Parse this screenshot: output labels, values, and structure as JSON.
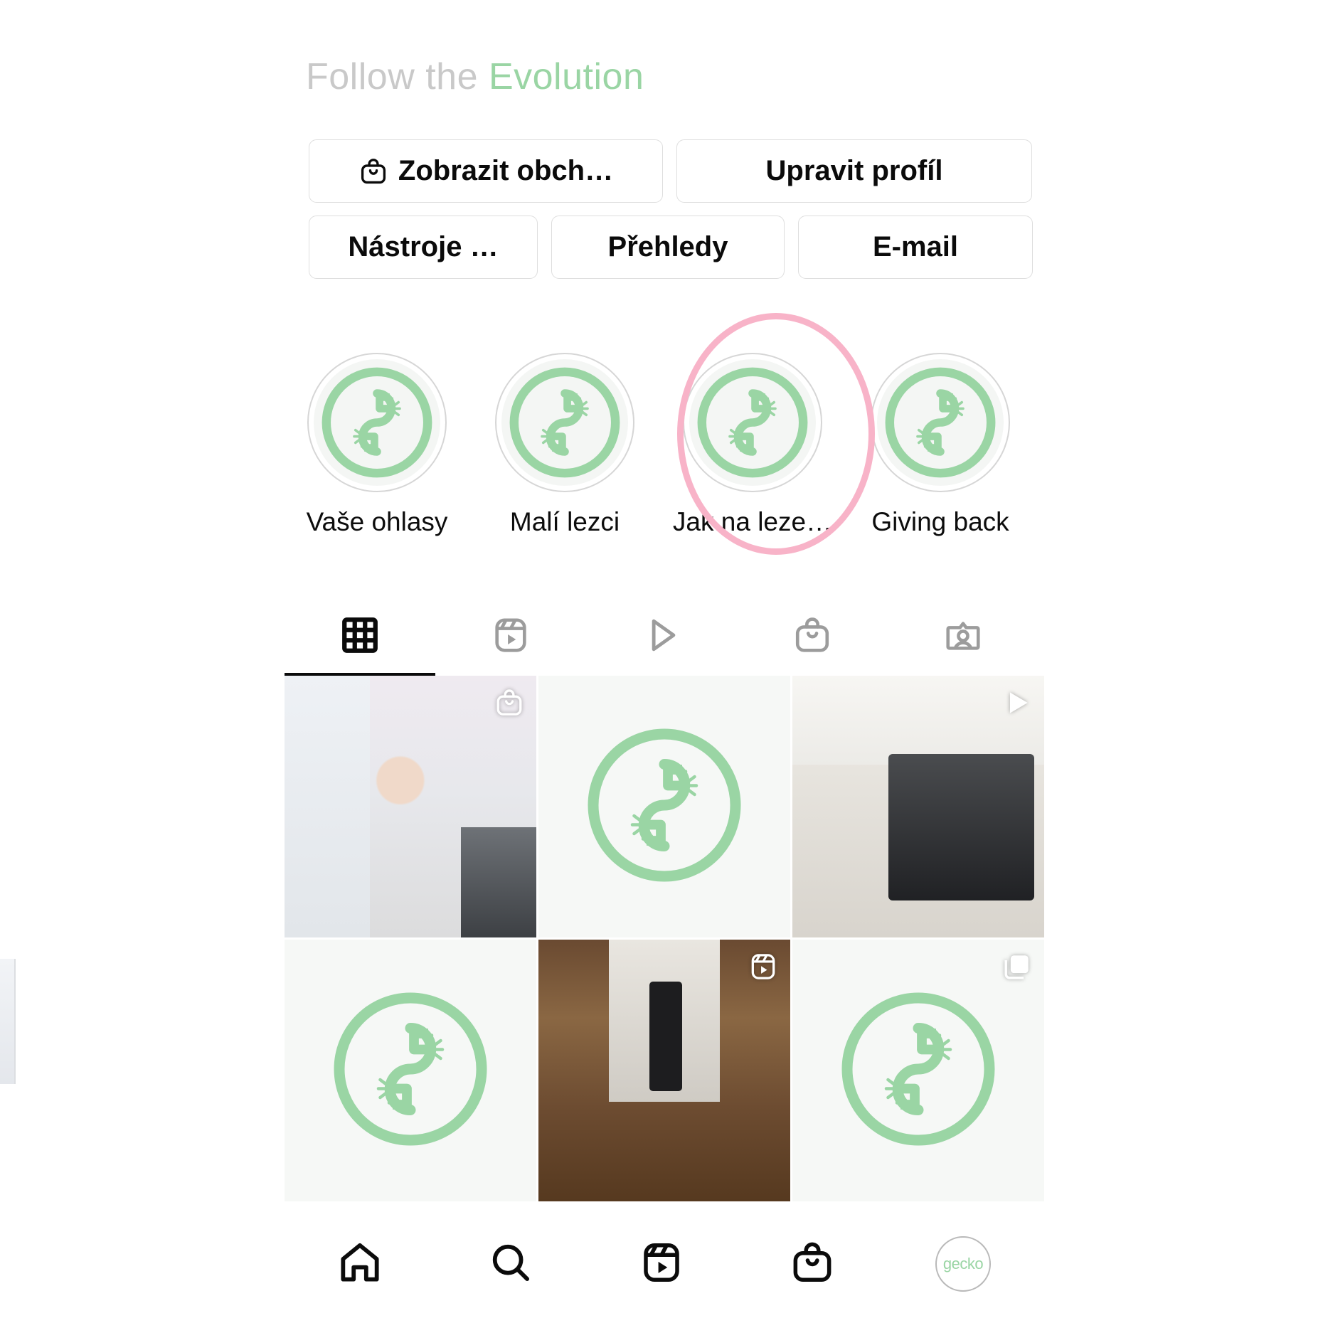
{
  "profile": {
    "bio_plain": "Follow the",
    "bio_accent": "Evolution",
    "accent_color": "#9ad5a4",
    "annotation_color": "#f8b3c8"
  },
  "actions": {
    "row1": [
      {
        "label": "Zobrazit obch…",
        "icon": "shop-bag-icon",
        "name": "view-shop-button"
      },
      {
        "label": "Upravit profíl",
        "icon": "",
        "name": "edit-profile-button"
      }
    ],
    "row2": [
      {
        "label": "Nástroje …",
        "icon": "",
        "name": "tools-button"
      },
      {
        "label": "Přehledy",
        "icon": "",
        "name": "insights-button"
      },
      {
        "label": "E-mail",
        "icon": "",
        "name": "email-button"
      }
    ]
  },
  "highlights": [
    {
      "label": "Vaše ohlasy",
      "name": "highlight-vase-ohlasy",
      "annotated": false
    },
    {
      "label": "Malí lezci",
      "name": "highlight-mali-lezci",
      "annotated": false
    },
    {
      "label": "Jak na leze…",
      "name": "highlight-jak-na-lezeni",
      "annotated": true
    },
    {
      "label": "Giving back",
      "name": "highlight-giving-back",
      "annotated": false
    }
  ],
  "content_tabs": [
    {
      "icon": "grid-icon",
      "name": "tab-grid",
      "active": true
    },
    {
      "icon": "reels-icon",
      "name": "tab-reels",
      "active": false
    },
    {
      "icon": "video-icon",
      "name": "tab-video",
      "active": false
    },
    {
      "icon": "shop-icon",
      "name": "tab-shop",
      "active": false
    },
    {
      "icon": "tagged-icon",
      "name": "tab-tagged",
      "active": false
    }
  ],
  "posts": [
    {
      "kind": "photo",
      "style": "photo-a",
      "badge": "shop-tag-icon"
    },
    {
      "kind": "logo",
      "style": "",
      "badge": ""
    },
    {
      "kind": "photo",
      "style": "photo-b",
      "badge": "video-play-icon"
    },
    {
      "kind": "logo",
      "style": "",
      "badge": ""
    },
    {
      "kind": "photo",
      "style": "photo-c",
      "badge": "reels-badge-icon"
    },
    {
      "kind": "logo",
      "style": "",
      "badge": "carousel-icon"
    }
  ],
  "bottom_nav": [
    {
      "icon": "home-icon",
      "name": "nav-home"
    },
    {
      "icon": "search-icon",
      "name": "nav-search"
    },
    {
      "icon": "reels-icon",
      "name": "nav-reels"
    },
    {
      "icon": "shop-icon",
      "name": "nav-shop"
    },
    {
      "icon": "avatar-icon",
      "name": "nav-profile",
      "avatar_text": "gecko"
    }
  ]
}
